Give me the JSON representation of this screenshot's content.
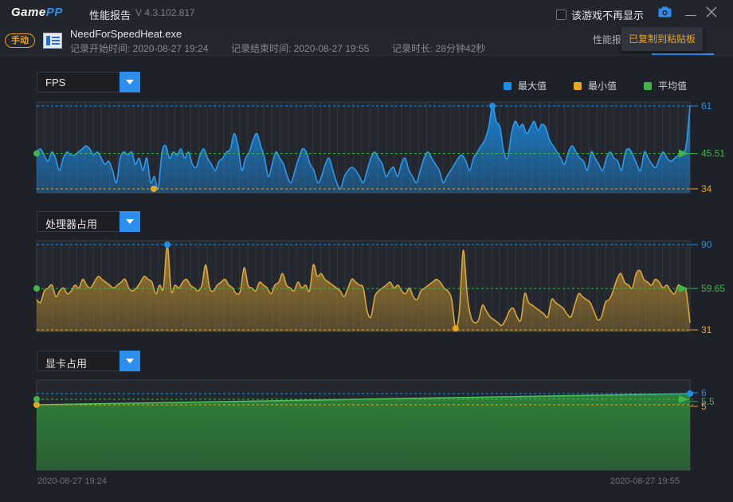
{
  "app": {
    "logo_main": "Game",
    "logo_accent": "PP",
    "title": "性能报告",
    "version": "V 4.3.102.817",
    "no_show_label": "该游戏不再显示"
  },
  "session": {
    "mode_badge": "手动",
    "exe_name": "NeedForSpeedHeat.exe",
    "start_time": "记录开始时间: 2020-08-27 19:24",
    "end_time": "记录结束时间: 2020-08-27 19:55",
    "duration": "记录时长: 28分钟42秒"
  },
  "tabs": {
    "report_label": "性能报"
  },
  "toast": {
    "text": "已复制到粘贴板"
  },
  "legend": [
    {
      "label": "最大值",
      "color": "#1a8fe8"
    },
    {
      "label": "最小值",
      "color": "#e8a520"
    },
    {
      "label": "平均值",
      "color": "#3fb54a"
    }
  ],
  "charts": [
    {
      "id": "fps",
      "select_label": "FPS",
      "max": 61,
      "min": 34,
      "avg": 45.51,
      "max_label": "61",
      "min_label": "34",
      "avg_label": "45.51",
      "color": "#1a8fe8",
      "series": [
        46,
        47,
        45,
        43,
        46,
        44,
        40,
        44,
        46,
        45,
        45,
        46,
        47,
        48,
        47,
        45,
        46,
        44,
        42,
        43,
        40,
        36,
        44,
        46,
        45,
        46,
        42,
        44,
        40,
        44,
        36,
        38,
        34,
        46,
        48,
        44,
        46,
        45,
        47,
        44,
        46,
        42,
        41,
        45,
        47,
        44,
        42,
        40,
        43,
        44,
        46,
        47,
        52,
        48,
        40,
        44,
        46,
        50,
        52,
        48,
        44,
        38,
        42,
        46,
        44,
        42,
        38,
        36,
        40,
        44,
        47,
        46,
        42,
        40,
        36,
        38,
        42,
        44,
        40,
        36,
        34,
        38,
        40,
        41,
        40,
        38,
        36,
        40,
        44,
        46,
        44,
        42,
        38,
        40,
        41,
        38,
        42,
        44,
        40,
        38,
        36,
        40,
        44,
        46,
        44,
        42,
        40,
        36,
        38,
        40,
        42,
        44,
        45,
        43,
        40,
        44,
        46,
        48,
        50,
        54,
        61,
        56,
        54,
        46,
        44,
        52,
        56,
        54,
        55,
        52,
        54,
        56,
        53,
        55,
        54,
        50,
        48,
        46,
        44,
        42,
        46,
        48,
        46,
        44,
        43,
        40,
        46,
        44,
        42,
        40,
        44,
        46,
        44,
        43,
        40,
        46,
        47,
        45,
        42,
        40,
        46,
        44,
        42,
        41,
        44,
        46,
        44,
        43,
        44,
        45,
        46,
        48,
        61
      ]
    },
    {
      "id": "cpu",
      "select_label": "处理器占用",
      "max": 90,
      "min": 31,
      "avg": 59.65,
      "max_label": "90",
      "min_label": "31",
      "avg_label": "59.65",
      "color": "#c9962e",
      "series": [
        52,
        50,
        58,
        60,
        62,
        54,
        58,
        60,
        56,
        58,
        62,
        60,
        66,
        62,
        60,
        64,
        68,
        66,
        64,
        62,
        60,
        62,
        64,
        66,
        60,
        58,
        60,
        64,
        68,
        66,
        64,
        56,
        62,
        60,
        90,
        58,
        62,
        60,
        64,
        66,
        62,
        60,
        58,
        62,
        76,
        60,
        58,
        62,
        64,
        66,
        62,
        60,
        56,
        58,
        74,
        62,
        60,
        58,
        64,
        62,
        60,
        56,
        62,
        64,
        70,
        62,
        60,
        58,
        64,
        60,
        62,
        58,
        76,
        68,
        70,
        66,
        64,
        62,
        60,
        58,
        54,
        60,
        66,
        64,
        62,
        60,
        44,
        40,
        54,
        58,
        60,
        62,
        64,
        60,
        62,
        58,
        56,
        60,
        54,
        52,
        58,
        60,
        62,
        64,
        66,
        64,
        60,
        58,
        52,
        32,
        44,
        86,
        56,
        40,
        36,
        38,
        48,
        44,
        40,
        38,
        36,
        34,
        38,
        44,
        46,
        40,
        38,
        56,
        50,
        48,
        46,
        44,
        42,
        40,
        52,
        50,
        48,
        46,
        42,
        40,
        48,
        56,
        54,
        52,
        50,
        44,
        38,
        40,
        50,
        52,
        58,
        66,
        70,
        64,
        62,
        60,
        70,
        72,
        66,
        64,
        62,
        66,
        64,
        60,
        62,
        58,
        56,
        62,
        60,
        58,
        36
      ]
    },
    {
      "id": "gpu",
      "select_label": "显卡占用",
      "max": 6,
      "min": 5,
      "avg": 5.5,
      "max_label": "6",
      "min_label": "5",
      "avg_label": "5.5",
      "color": "#3fb54a",
      "series": [
        5,
        6
      ]
    }
  ],
  "time_axis": {
    "start": "2020-08-27 19:24",
    "end": "2020-08-27 19:55"
  }
}
